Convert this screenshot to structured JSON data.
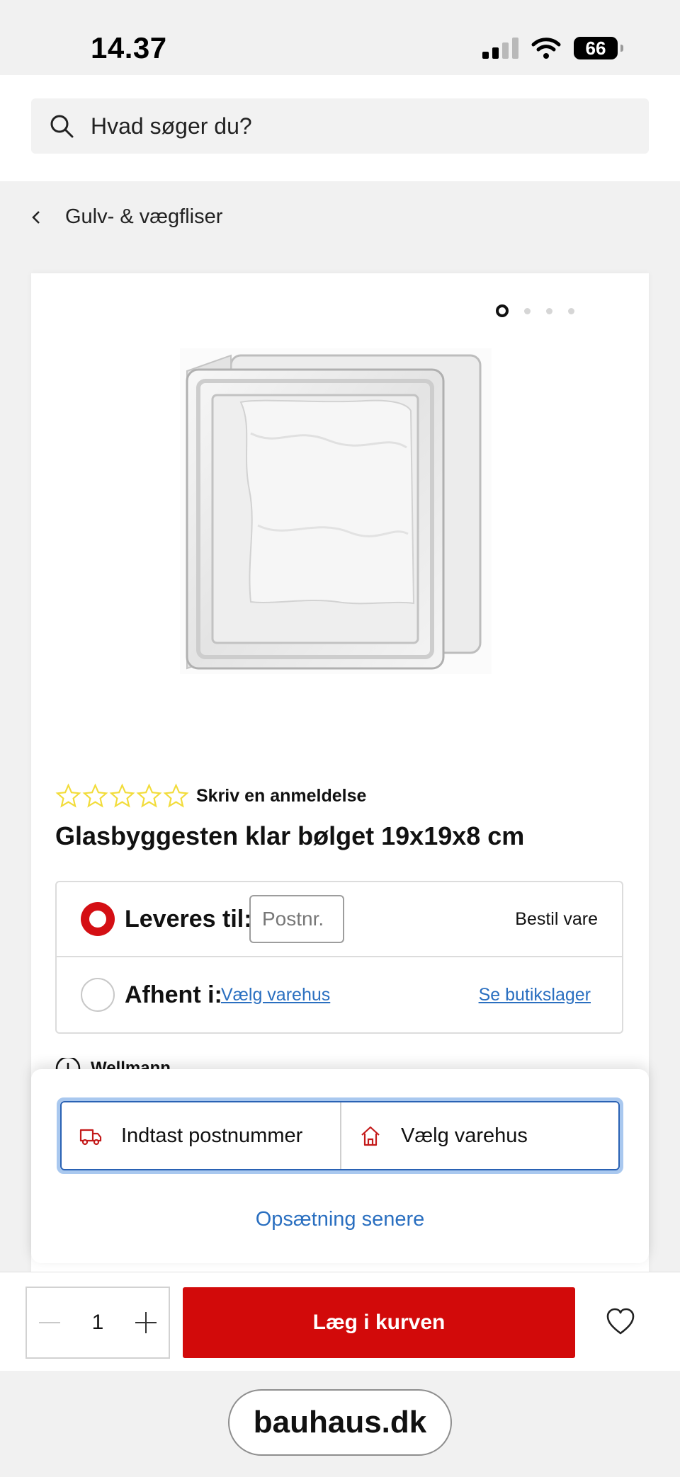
{
  "status_bar": {
    "time": "14.37",
    "battery": "66"
  },
  "search": {
    "placeholder": "Hvad søger du?"
  },
  "breadcrumb": {
    "label": "Gulv- & vægfliser"
  },
  "product": {
    "image_icon": "glass-block-image",
    "carousel": {
      "count": 4,
      "active": 0
    },
    "rating": {
      "stars": 5,
      "filled": 0,
      "review_link": "Skriv en anmeldelse"
    },
    "title": "Glasbyggesten klar bølget 19x19x8 cm"
  },
  "delivery": {
    "deliver_label": "Leveres til:",
    "postnr_placeholder": "Postnr.",
    "order_text": "Bestil vare",
    "pickup_label": "Afhent i:",
    "choose_store_link": "Vælg varehus",
    "store_stock_link": "Se butikslager"
  },
  "brand": {
    "name": "Wellmann"
  },
  "popup": {
    "enter_postcode": "Indtast postnummer",
    "choose_store": "Vælg varehus",
    "later": "Opsætning senere"
  },
  "cart": {
    "quantity": "1",
    "add_label": "Læg i kurven"
  },
  "browser": {
    "url": "bauhaus.dk"
  },
  "colors": {
    "accent_red": "#d20a0a",
    "link_blue": "#2a6fc0",
    "star_yellow": "#f2dc3a"
  }
}
